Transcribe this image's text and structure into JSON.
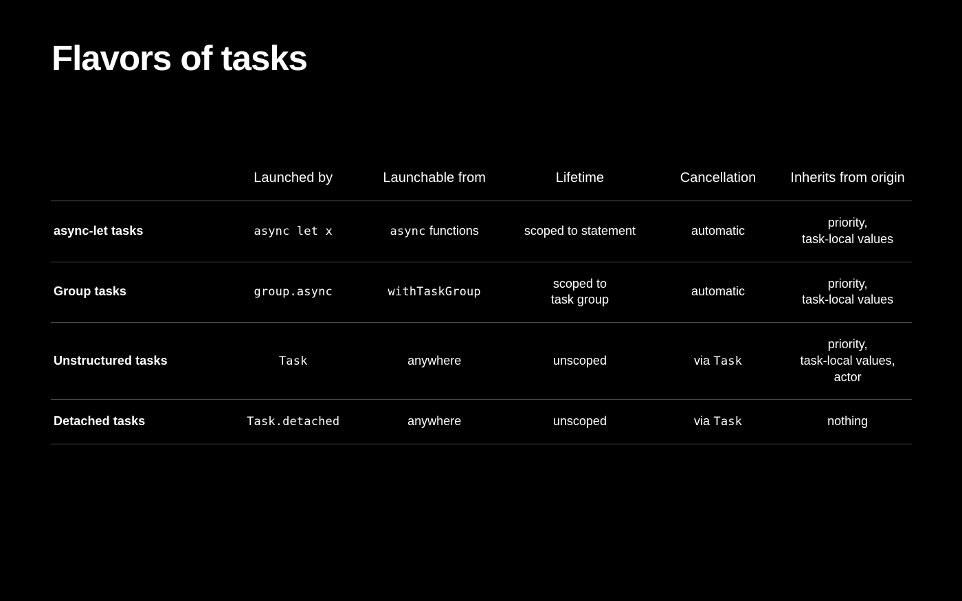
{
  "slide": {
    "title": "Flavors of tasks",
    "background_color": "#000000",
    "text_color": "#ffffff",
    "rule_color": "#4a4a4a"
  },
  "table": {
    "row_label_header": "",
    "columns": [
      "Launched by",
      "Launchable from",
      "Lifetime",
      "Cancellation",
      "Inherits from origin"
    ],
    "rows": [
      {
        "label": "async-let tasks",
        "launched_by": "async let x",
        "launched_by_style": "mono",
        "launchable_from_mono": "async",
        "launchable_from_text": "functions",
        "lifetime": [
          "scoped to statement"
        ],
        "cancellation_text": "automatic",
        "cancellation_mono": "",
        "inherits": [
          "priority,",
          "task-local values"
        ]
      },
      {
        "label": "Group tasks",
        "launched_by": "group.async",
        "launched_by_style": "mono",
        "launchable_from_mono": "withTaskGroup",
        "launchable_from_text": "",
        "lifetime": [
          "scoped to",
          "task group"
        ],
        "cancellation_text": "automatic",
        "cancellation_mono": "",
        "inherits": [
          "priority,",
          "task-local values"
        ]
      },
      {
        "label": "Unstructured tasks",
        "launched_by": "Task",
        "launched_by_style": "mono",
        "launchable_from_mono": "",
        "launchable_from_text": "anywhere",
        "lifetime": [
          "unscoped"
        ],
        "cancellation_text": "via",
        "cancellation_mono": "Task",
        "inherits": [
          "priority,",
          "task-local values,",
          "actor"
        ]
      },
      {
        "label": "Detached tasks",
        "launched_by": "Task.detached",
        "launched_by_style": "mono",
        "launchable_from_mono": "",
        "launchable_from_text": "anywhere",
        "lifetime": [
          "unscoped"
        ],
        "cancellation_text": "via",
        "cancellation_mono": "Task",
        "inherits": [
          "nothing"
        ]
      }
    ]
  }
}
